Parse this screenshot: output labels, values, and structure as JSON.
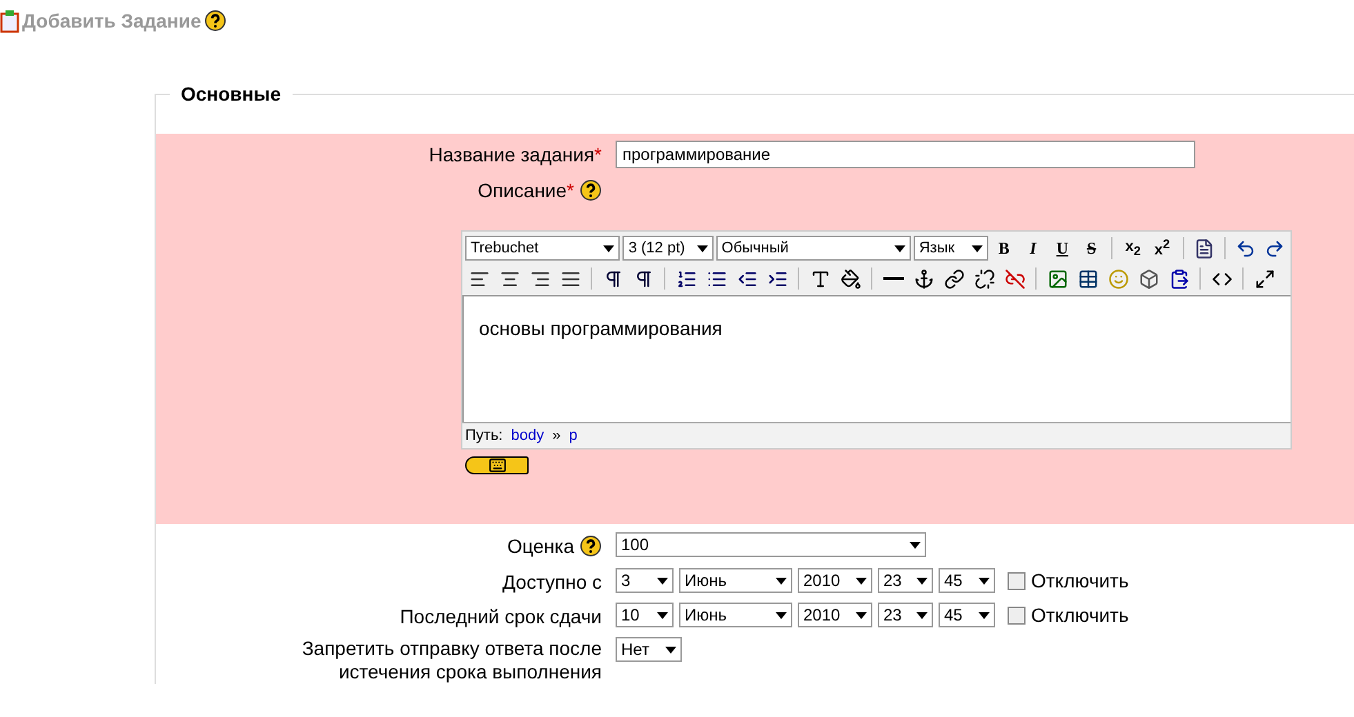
{
  "page_title": "Добавить Задание",
  "section": {
    "legend": "Основные"
  },
  "name_field": {
    "label": "Название задания",
    "required_mark": "*",
    "value": "программирование"
  },
  "description": {
    "label": "Описание",
    "required_mark": "*",
    "toolbar_selects": [
      "Trebuchet",
      "3 (12 pt)",
      "Обычный",
      "Язык"
    ],
    "format_buttons": [
      "B",
      "I",
      "U",
      "S"
    ],
    "script_buttons": [
      "x$_{2}$",
      "x$^{2}$"
    ],
    "content": "основы программирования",
    "path": {
      "label": "Путь:",
      "items": [
        "body",
        "p"
      ],
      "separator": "»"
    }
  },
  "grade": {
    "label": "Оценка",
    "value": "100"
  },
  "dates": [
    {
      "label": "Доступно с",
      "day": "3",
      "month": "Июнь",
      "year": "2010",
      "hour": "23",
      "minute": "45",
      "disable_label": "Отключить",
      "disabled_checked": false
    },
    {
      "label": "Последний срок сдачи",
      "day": "10",
      "month": "Июнь",
      "year": "2010",
      "hour": "23",
      "minute": "45",
      "disable_label": "Отключить",
      "disabled_checked": false
    }
  ],
  "prevent_late": {
    "label": "Запретить отправку ответа после истечения срока выполнения",
    "value": "Нет"
  }
}
